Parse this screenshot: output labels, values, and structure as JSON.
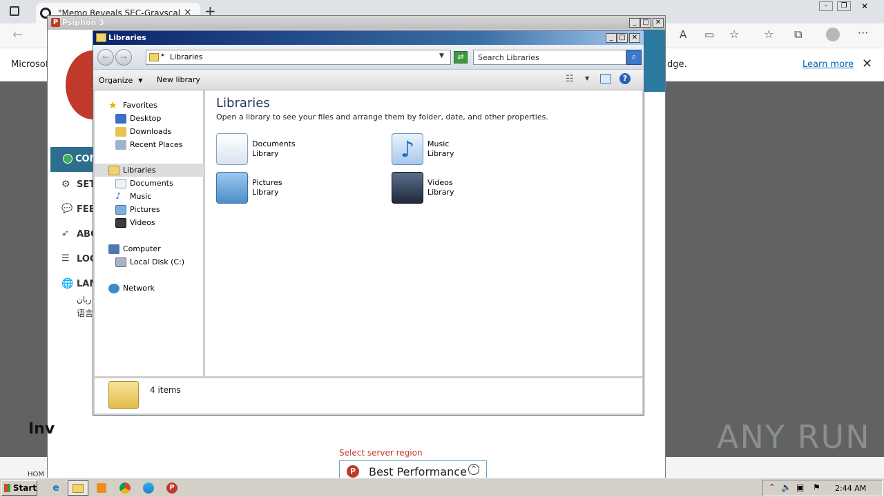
{
  "browser": {
    "tab_title": "\"Memo Reveals SEC-Grayscale M",
    "infobar_text_left": "Microsof",
    "infobar_text_right": "dge.",
    "learn_more": "Learn more"
  },
  "psiphon": {
    "title": "Psiphon 3",
    "menu": [
      {
        "label": "CON",
        "icon": "check-circle-icon"
      },
      {
        "label": "SET",
        "icon": "gear-icon"
      },
      {
        "label": "FEE",
        "icon": "comment-icon"
      },
      {
        "label": "ABO",
        "icon": "rocket-icon"
      },
      {
        "label": "LOG",
        "icon": "list-icon"
      },
      {
        "label": "LAN",
        "icon": "globe-icon"
      }
    ],
    "lang_line1": "ربان",
    "lang_line2": "语言",
    "heading_partial": "Inv",
    "footer_partial": "HOM",
    "server_region_label": "Select server region",
    "server_region_value": "Best Performance"
  },
  "explorer": {
    "title": "Libraries",
    "address": "Libraries",
    "search_placeholder": "Search Libraries",
    "cmd": {
      "organize": "Organize",
      "new_library": "New library"
    },
    "nav": {
      "favorites": "Favorites",
      "favorites_items": [
        "Desktop",
        "Downloads",
        "Recent Places"
      ],
      "libraries": "Libraries",
      "libraries_items": [
        "Documents",
        "Music",
        "Pictures",
        "Videos"
      ],
      "computer": "Computer",
      "computer_items": [
        "Local Disk (C:)"
      ],
      "network": "Network"
    },
    "content": {
      "heading": "Libraries",
      "subheading": "Open a library to see your files and arrange them by folder, date, and other properties.",
      "libraries": [
        {
          "name": "Documents",
          "type": "Library"
        },
        {
          "name": "Music",
          "type": "Library"
        },
        {
          "name": "Pictures",
          "type": "Library"
        },
        {
          "name": "Videos",
          "type": "Library"
        }
      ]
    },
    "status": "4 items"
  },
  "taskbar": {
    "start": "Start",
    "clock": "2:44 AM"
  },
  "watermark": "ANY RUN"
}
